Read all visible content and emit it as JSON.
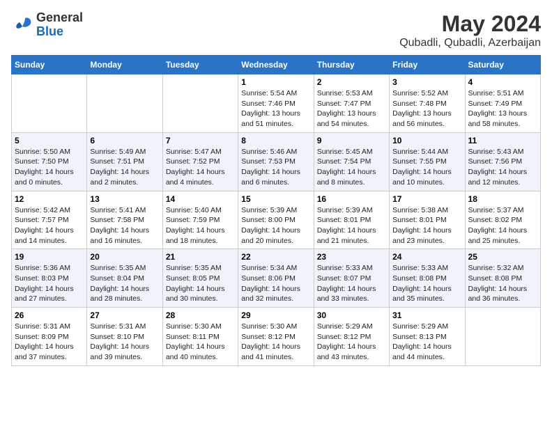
{
  "header": {
    "logo_general": "General",
    "logo_blue": "Blue",
    "title": "May 2024",
    "subtitle": "Qubadli, Qubadli, Azerbaijan"
  },
  "calendar": {
    "days_of_week": [
      "Sunday",
      "Monday",
      "Tuesday",
      "Wednesday",
      "Thursday",
      "Friday",
      "Saturday"
    ],
    "weeks": [
      [
        {
          "day": "",
          "info": ""
        },
        {
          "day": "",
          "info": ""
        },
        {
          "day": "",
          "info": ""
        },
        {
          "day": "1",
          "info": "Sunrise: 5:54 AM\nSunset: 7:46 PM\nDaylight: 13 hours\nand 51 minutes."
        },
        {
          "day": "2",
          "info": "Sunrise: 5:53 AM\nSunset: 7:47 PM\nDaylight: 13 hours\nand 54 minutes."
        },
        {
          "day": "3",
          "info": "Sunrise: 5:52 AM\nSunset: 7:48 PM\nDaylight: 13 hours\nand 56 minutes."
        },
        {
          "day": "4",
          "info": "Sunrise: 5:51 AM\nSunset: 7:49 PM\nDaylight: 13 hours\nand 58 minutes."
        }
      ],
      [
        {
          "day": "5",
          "info": "Sunrise: 5:50 AM\nSunset: 7:50 PM\nDaylight: 14 hours\nand 0 minutes."
        },
        {
          "day": "6",
          "info": "Sunrise: 5:49 AM\nSunset: 7:51 PM\nDaylight: 14 hours\nand 2 minutes."
        },
        {
          "day": "7",
          "info": "Sunrise: 5:47 AM\nSunset: 7:52 PM\nDaylight: 14 hours\nand 4 minutes."
        },
        {
          "day": "8",
          "info": "Sunrise: 5:46 AM\nSunset: 7:53 PM\nDaylight: 14 hours\nand 6 minutes."
        },
        {
          "day": "9",
          "info": "Sunrise: 5:45 AM\nSunset: 7:54 PM\nDaylight: 14 hours\nand 8 minutes."
        },
        {
          "day": "10",
          "info": "Sunrise: 5:44 AM\nSunset: 7:55 PM\nDaylight: 14 hours\nand 10 minutes."
        },
        {
          "day": "11",
          "info": "Sunrise: 5:43 AM\nSunset: 7:56 PM\nDaylight: 14 hours\nand 12 minutes."
        }
      ],
      [
        {
          "day": "12",
          "info": "Sunrise: 5:42 AM\nSunset: 7:57 PM\nDaylight: 14 hours\nand 14 minutes."
        },
        {
          "day": "13",
          "info": "Sunrise: 5:41 AM\nSunset: 7:58 PM\nDaylight: 14 hours\nand 16 minutes."
        },
        {
          "day": "14",
          "info": "Sunrise: 5:40 AM\nSunset: 7:59 PM\nDaylight: 14 hours\nand 18 minutes."
        },
        {
          "day": "15",
          "info": "Sunrise: 5:39 AM\nSunset: 8:00 PM\nDaylight: 14 hours\nand 20 minutes."
        },
        {
          "day": "16",
          "info": "Sunrise: 5:39 AM\nSunset: 8:01 PM\nDaylight: 14 hours\nand 21 minutes."
        },
        {
          "day": "17",
          "info": "Sunrise: 5:38 AM\nSunset: 8:01 PM\nDaylight: 14 hours\nand 23 minutes."
        },
        {
          "day": "18",
          "info": "Sunrise: 5:37 AM\nSunset: 8:02 PM\nDaylight: 14 hours\nand 25 minutes."
        }
      ],
      [
        {
          "day": "19",
          "info": "Sunrise: 5:36 AM\nSunset: 8:03 PM\nDaylight: 14 hours\nand 27 minutes."
        },
        {
          "day": "20",
          "info": "Sunrise: 5:35 AM\nSunset: 8:04 PM\nDaylight: 14 hours\nand 28 minutes."
        },
        {
          "day": "21",
          "info": "Sunrise: 5:35 AM\nSunset: 8:05 PM\nDaylight: 14 hours\nand 30 minutes."
        },
        {
          "day": "22",
          "info": "Sunrise: 5:34 AM\nSunset: 8:06 PM\nDaylight: 14 hours\nand 32 minutes."
        },
        {
          "day": "23",
          "info": "Sunrise: 5:33 AM\nSunset: 8:07 PM\nDaylight: 14 hours\nand 33 minutes."
        },
        {
          "day": "24",
          "info": "Sunrise: 5:33 AM\nSunset: 8:08 PM\nDaylight: 14 hours\nand 35 minutes."
        },
        {
          "day": "25",
          "info": "Sunrise: 5:32 AM\nSunset: 8:08 PM\nDaylight: 14 hours\nand 36 minutes."
        }
      ],
      [
        {
          "day": "26",
          "info": "Sunrise: 5:31 AM\nSunset: 8:09 PM\nDaylight: 14 hours\nand 37 minutes."
        },
        {
          "day": "27",
          "info": "Sunrise: 5:31 AM\nSunset: 8:10 PM\nDaylight: 14 hours\nand 39 minutes."
        },
        {
          "day": "28",
          "info": "Sunrise: 5:30 AM\nSunset: 8:11 PM\nDaylight: 14 hours\nand 40 minutes."
        },
        {
          "day": "29",
          "info": "Sunrise: 5:30 AM\nSunset: 8:12 PM\nDaylight: 14 hours\nand 41 minutes."
        },
        {
          "day": "30",
          "info": "Sunrise: 5:29 AM\nSunset: 8:12 PM\nDaylight: 14 hours\nand 43 minutes."
        },
        {
          "day": "31",
          "info": "Sunrise: 5:29 AM\nSunset: 8:13 PM\nDaylight: 14 hours\nand 44 minutes."
        },
        {
          "day": "",
          "info": ""
        }
      ]
    ]
  }
}
